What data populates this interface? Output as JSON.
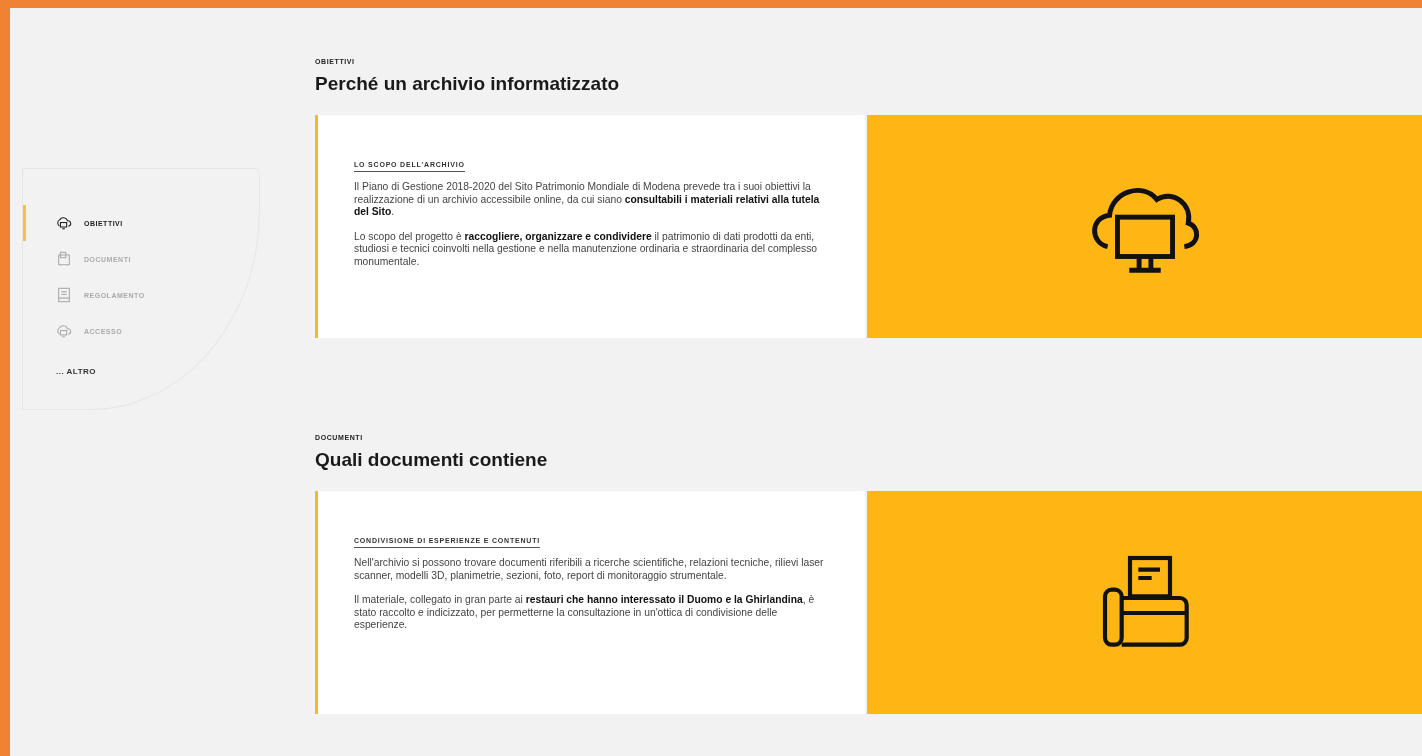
{
  "sidebar": {
    "items": [
      {
        "label": "OBIETTIVI",
        "selected": true
      },
      {
        "label": "DOCUMENTI",
        "selected": false
      },
      {
        "label": "REGOLAMENTO",
        "selected": false
      },
      {
        "label": "ACCESSO",
        "selected": false
      }
    ],
    "more": "... ALTRO"
  },
  "sections": [
    {
      "eyebrow": "OBIETTIVI",
      "title": "Perché un archivio informatizzato",
      "card": {
        "heading": "LO SCOPO DELL'ARCHIVIO",
        "paragraphs": [
          "Il Piano di Gestione 2018-2020 del Sito Patrimonio Mondiale di Modena prevede tra i suoi obiettivi la realizzazione di un archivio accessibile online, da cui siano **consultabili i materiali relativi alla tutela del Sito**.",
          "Lo scopo del progetto è **raccogliere, organizzare e condividere** il patrimonio di dati prodotti da enti, studiosi e tecnici coinvolti nella gestione e nella manutenzione ordinaria e straordinaria del complesso monumentale."
        ]
      }
    },
    {
      "eyebrow": "DOCUMENTI",
      "title": "Quali documenti contiene",
      "card": {
        "heading": "CONDIVISIONE DI ESPERIENZE E CONTENUTI",
        "paragraphs": [
          "Nell'archivio si possono trovare documenti riferibili a ricerche scientifiche, relazioni tecniche, rilievi laser scanner, modelli 3D, planimetrie, sezioni, foto, report di monitoraggio strumentale.",
          "Il materiale, collegato in gran parte ai **restauri che hanno interessato il Duomo e la Ghirlandina**, è stato raccolto e indicizzato, per permetterne la consultazione in un'ottica di condivisione delle esperienze."
        ]
      }
    }
  ]
}
